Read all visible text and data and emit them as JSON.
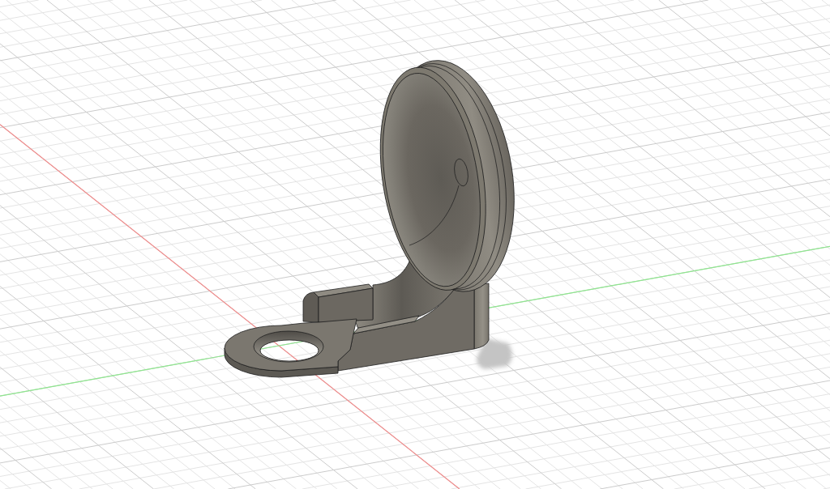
{
  "viewport": {
    "axes": [
      {
        "kind": "x",
        "color": "#f08c8c"
      },
      {
        "kind": "y",
        "color": "#8ee68e"
      }
    ]
  }
}
